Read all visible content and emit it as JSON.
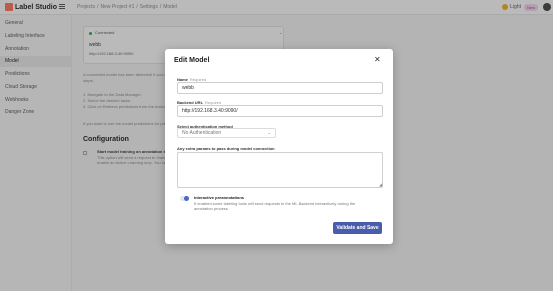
{
  "app": {
    "logo_text": "Label Studio"
  },
  "breadcrumb": [
    "Projects",
    "New Project #1",
    "Settings",
    "Model"
  ],
  "header": {
    "theme_label": "Light",
    "badge": "New"
  },
  "sidebar": {
    "items": [
      {
        "label": "General"
      },
      {
        "label": "Labeling Interface"
      },
      {
        "label": "Annotation"
      },
      {
        "label": "Model",
        "active": true
      },
      {
        "label": "Predictions"
      },
      {
        "label": "Cloud Storage"
      },
      {
        "label": "Webhooks"
      },
      {
        "label": "Danger Zone"
      }
    ]
  },
  "background": {
    "card": {
      "status": "Connected",
      "name": "webb",
      "url": "http://192.168.3.40:9090/"
    },
    "text_lines": [
      "A connected model has been detected! If you wish to fetch predictions from this model, please follow these",
      "steps:",
      "1. Navigate to the Data Manager.",
      "2. Select the desired tasks.",
      "3. Click on Retrieve predictions from the Actions menu.",
      "If you want to use the model predictions for prelabeling, please configure this in the Annotation settings."
    ],
    "config_title": "Configuration",
    "config_option": "Start model training on annotation submission",
    "config_desc": [
      "This option will send a request to /train with information about annotations. You can use this to",
      "enable an Active Learning loop. You can also manually start training through model menu."
    ]
  },
  "modal": {
    "title": "Edit Model",
    "close_glyph": "✕",
    "required_text": "Required",
    "name_label": "Name",
    "name_value": "webb",
    "url_label": "Backend URL",
    "url_value": "http://192.168.3.40:9090/",
    "auth_label": "Select authentication method",
    "auth_value": "No Authentication",
    "extra_label": "Any extra params to pass during model connection",
    "extra_value": "",
    "interactive_title": "Interactive preannotations",
    "interactive_desc": "If enabled some labeling tools will send requests to the ML Backend interactively during the annotation process.",
    "interactive_enabled": true,
    "save_label": "Validate and Save"
  },
  "colors": {
    "accent": "#4a5dad",
    "toggle": "#4a67c9",
    "logo": "#ff7557",
    "connected": "#3aa655"
  }
}
